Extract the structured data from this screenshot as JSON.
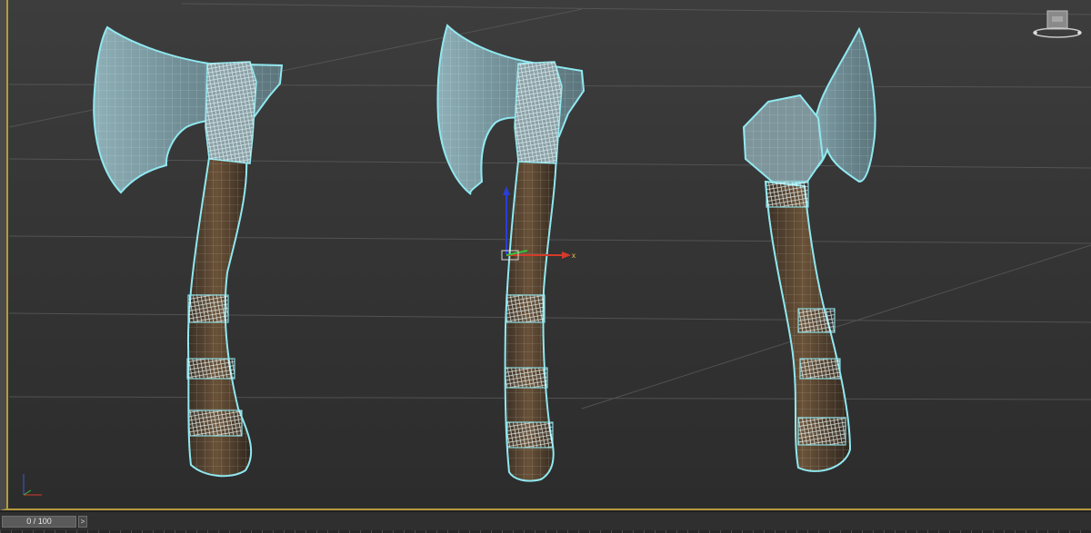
{
  "app": {
    "viewport": {
      "background_color": "#343434",
      "selection_wire_color": "#8fe8f0",
      "mesh_colors": {
        "blade": "#7b98a0",
        "handle": "#5a4632",
        "wrap": "#b9c3c2"
      },
      "gizmo": {
        "x_label": "x",
        "x_color": "#d43a2a",
        "y_color": "#3fbf3f",
        "z_color": "#2a3fd4"
      },
      "corner_axis": {
        "x_color": "#d43a2a",
        "y_color": "#3fbf3f",
        "z_color": "#3a5ad4"
      },
      "objects": [
        "axe-front",
        "axe-middle",
        "axe-side"
      ],
      "viewcube_icon": "viewcube-icon"
    },
    "timeline": {
      "slider_label": "0 / 100",
      "next_button": ">"
    }
  }
}
